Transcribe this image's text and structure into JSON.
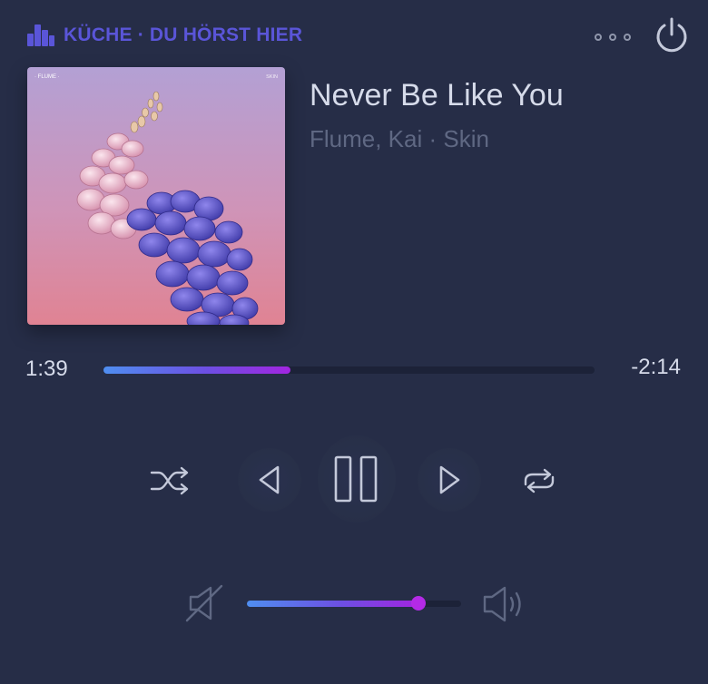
{
  "header": {
    "room_label": "KÜCHE · DU HÖRST HIER",
    "accent_color": "#5a55d8",
    "room_icon": "speaker-bars-icon",
    "more_icon": "more-dots-icon",
    "power_icon": "power-icon"
  },
  "track": {
    "title": "Never Be Like You",
    "meta": "Flume, Kai · Skin",
    "album_art": {
      "top_left_text": "· FLUME ·",
      "top_right_text": "SKIN"
    }
  },
  "progress": {
    "elapsed": "1:39",
    "remaining": "-2:14",
    "fraction": 0.38
  },
  "controls": {
    "shuffle_icon": "shuffle-icon",
    "previous_icon": "previous-icon",
    "play_pause_icon": "pause-icon",
    "next_icon": "next-icon",
    "repeat_icon": "repeat-icon"
  },
  "volume": {
    "level": 0.8,
    "mute_icon": "speaker-muted-icon",
    "volume_up_icon": "speaker-loud-icon"
  },
  "colors": {
    "background": "#262d47",
    "gradient_start": "#4f8ef0",
    "gradient_end": "#a225e0"
  }
}
